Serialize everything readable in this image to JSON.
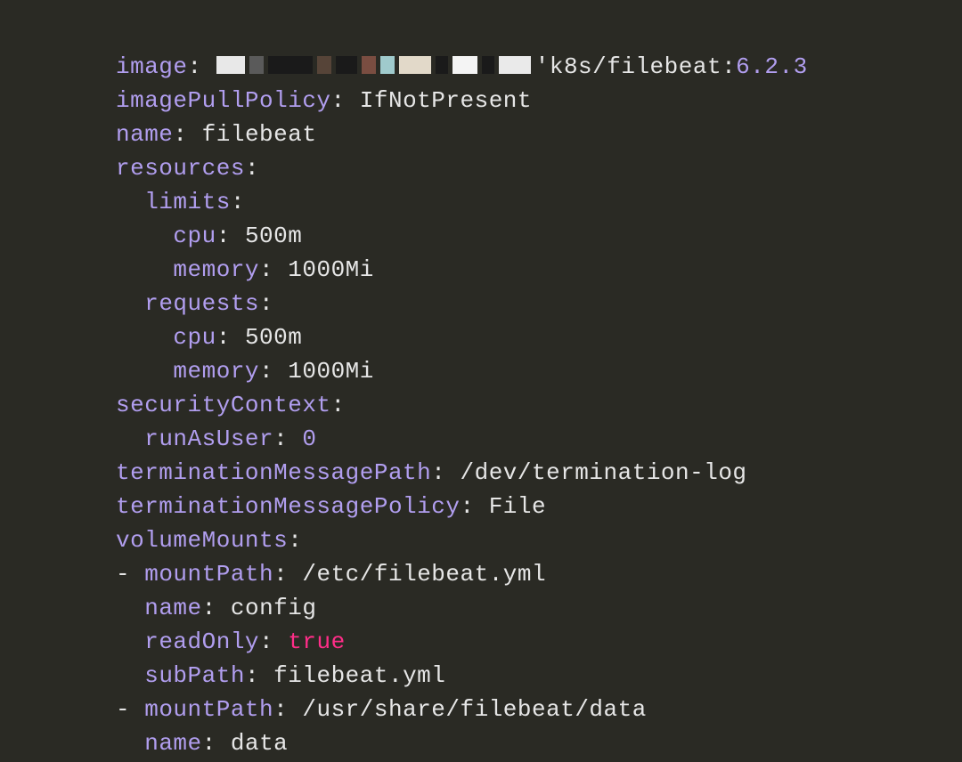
{
  "keys": {
    "image": "image",
    "imagePullPolicy": "imagePullPolicy",
    "name": "name",
    "resources": "resources",
    "limits": "limits",
    "cpu": "cpu",
    "memory": "memory",
    "requests": "requests",
    "securityContext": "securityContext",
    "runAsUser": "runAsUser",
    "terminationMessagePath": "terminationMessagePath",
    "terminationMessagePolicy": "terminationMessagePolicy",
    "volumeMounts": "volumeMounts",
    "mountPath": "mountPath",
    "readOnly": "readOnly",
    "subPath": "subPath"
  },
  "vals": {
    "imageSuffixPre": "'k8s/filebeat:",
    "imageVersion": "6.2.3",
    "imagePullPolicy": "IfNotPresent",
    "name": "filebeat",
    "limits_cpu": "500m",
    "limits_memory": "1000Mi",
    "requests_cpu": "500m",
    "requests_memory": "1000Mi",
    "runAsUser": "0",
    "terminationMessagePath": "/dev/termination-log",
    "terminationMessagePolicy": "File",
    "vm0_mountPath": "/etc/filebeat.yml",
    "vm0_name": "config",
    "vm0_readOnly": "true",
    "vm0_subPath": "filebeat.yml",
    "vm1_mountPath": "/usr/share/filebeat/data",
    "vm1_name": "data"
  },
  "sep": ": ",
  "sepOnly": ":",
  "dash": "- "
}
